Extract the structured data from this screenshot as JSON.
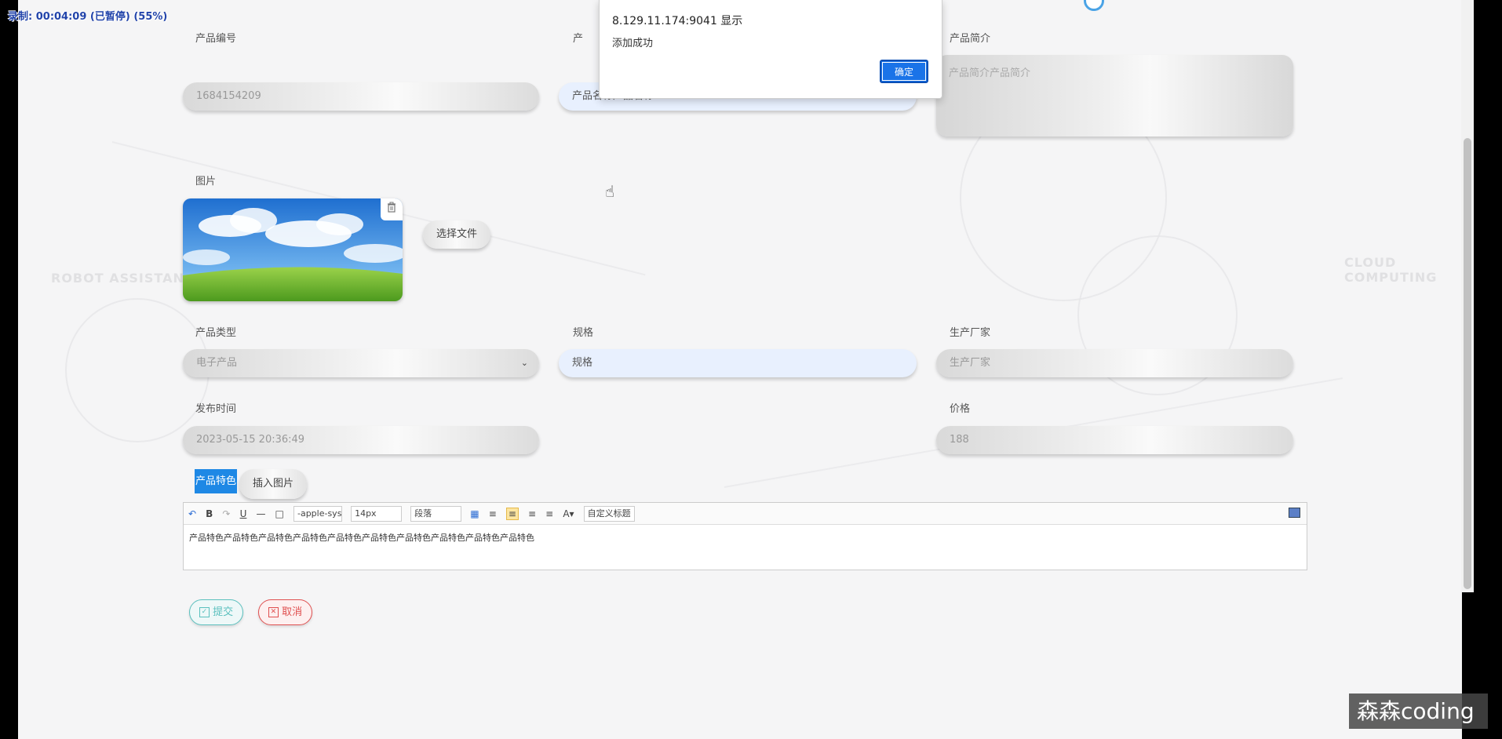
{
  "recording_overlay": "录制: 00:04:09 (已暂停) (55%)",
  "alert": {
    "title": "8.129.11.174:9041 显示",
    "message": "添加成功",
    "ok_label": "确定"
  },
  "form": {
    "product_no": {
      "label": "产品编号",
      "value": "1684154209"
    },
    "product_name": {
      "label": "产",
      "value": "产品名称产品名称"
    },
    "product_intro": {
      "label": "产品简介",
      "value": "产品简介产品简介"
    },
    "image": {
      "label": "图片",
      "choose_file_label": "选择文件"
    },
    "product_type": {
      "label": "产品类型",
      "selected": "电子产品"
    },
    "spec": {
      "label": "规格",
      "value": "规格"
    },
    "manufacturer": {
      "label": "生产厂家",
      "placeholder": "生产厂家"
    },
    "publish_time": {
      "label": "发布时间",
      "value": "2023-05-15 20:36:49"
    },
    "price": {
      "label": "价格",
      "value": "188"
    },
    "features": {
      "label": "产品特色",
      "insert_image_label": "插入图片",
      "content": "产品特色产品特色产品特色产品特色产品特色产品特色产品特色产品特色产品特色产品特色"
    }
  },
  "editor_toolbar": {
    "font_family": "-apple-sys",
    "font_size": "14px",
    "paragraph": "段落",
    "custom_title": "自定义标题"
  },
  "actions": {
    "submit_label": "提交",
    "cancel_label": "取消"
  },
  "watermark": "森森coding",
  "colors": {
    "accent": "#1e88e5",
    "submit": "#5bc0be",
    "cancel": "#e05050"
  }
}
